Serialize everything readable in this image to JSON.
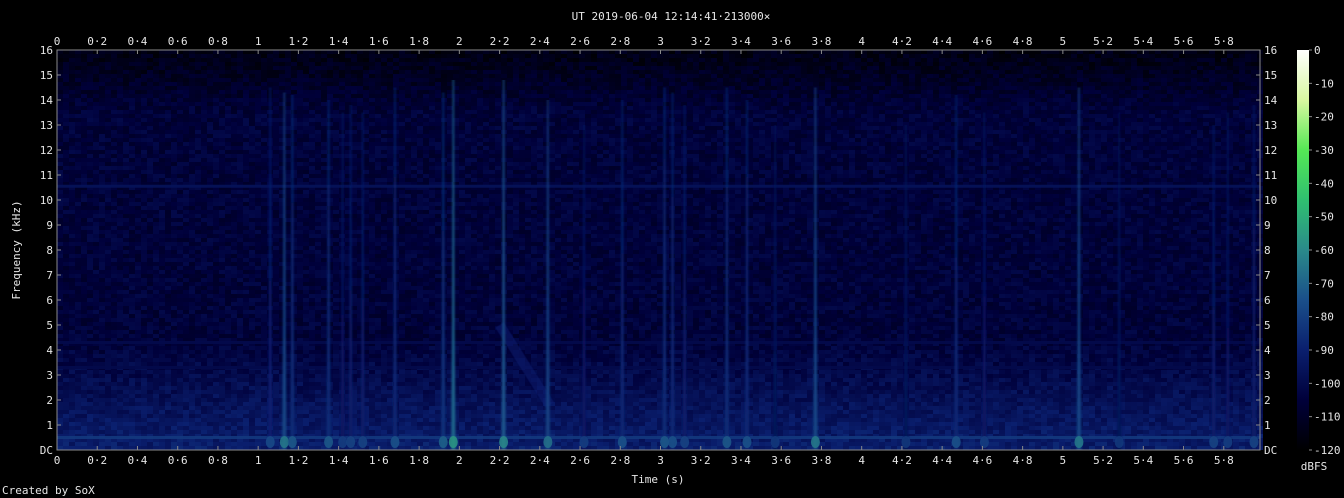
{
  "chart_data": {
    "type": "heatmap",
    "title": "UT 2019-06-04 12:14:41·213000×",
    "xlabel": "Time (s)",
    "ylabel": "Frequency (kHz)",
    "xlim": [
      0,
      5.98
    ],
    "ylim": [
      0,
      16
    ],
    "x_ticks": [
      "0",
      "0·2",
      "0·4",
      "0·6",
      "0·8",
      "1",
      "1·2",
      "1·4",
      "1·6",
      "1·8",
      "2",
      "2·2",
      "2·4",
      "2·6",
      "2·8",
      "3",
      "3·2",
      "3·4",
      "3·6",
      "3·8",
      "4",
      "4·2",
      "4·4",
      "4·6",
      "4·8",
      "5",
      "5·2",
      "5·4",
      "5·6",
      "5·8"
    ],
    "y_ticks": [
      "DC",
      "1",
      "2",
      "3",
      "4",
      "5",
      "6",
      "7",
      "8",
      "9",
      "10",
      "11",
      "12",
      "13",
      "14",
      "15",
      "16"
    ],
    "colorbar": {
      "label": "dBFS",
      "range": [
        -120,
        0
      ],
      "ticks": [
        "0",
        "-10",
        "-20",
        "-30",
        "-40",
        "-50",
        "-60",
        "-70",
        "-80",
        "-90",
        "-100",
        "-110",
        "-120"
      ],
      "colors": [
        "#000000",
        "#00003a",
        "#0a1f6e",
        "#1a4f8a",
        "#2a8a8a",
        "#2fc070",
        "#55e855",
        "#d8f8a0",
        "#ffffff"
      ]
    },
    "background_level_dbfs": -105,
    "horizontal_bands": [
      {
        "freq_khz": 0.5,
        "level_dbfs": -82
      },
      {
        "freq_khz": 3.3,
        "level_dbfs": -100
      },
      {
        "freq_khz": 4.3,
        "level_dbfs": -100
      },
      {
        "freq_khz": 10.55,
        "level_dbfs": -96
      }
    ],
    "clicks": [
      {
        "t": 1.06,
        "fmax": 14.5,
        "db": -90
      },
      {
        "t": 1.13,
        "fmax": 14.3,
        "db": -78
      },
      {
        "t": 1.17,
        "fmax": 14.2,
        "db": -86
      },
      {
        "t": 1.35,
        "fmax": 14.0,
        "db": -86
      },
      {
        "t": 1.42,
        "fmax": 13.5,
        "db": -94
      },
      {
        "t": 1.46,
        "fmax": 13.8,
        "db": -92
      },
      {
        "t": 1.52,
        "fmax": 13.5,
        "db": -92
      },
      {
        "t": 1.68,
        "fmax": 14.5,
        "db": -88
      },
      {
        "t": 1.92,
        "fmax": 14.3,
        "db": -84
      },
      {
        "t": 1.97,
        "fmax": 14.8,
        "db": -70
      },
      {
        "t": 2.22,
        "fmax": 14.8,
        "db": -74
      },
      {
        "t": 2.44,
        "fmax": 14.0,
        "db": -80
      },
      {
        "t": 2.62,
        "fmax": 13.0,
        "db": -94
      },
      {
        "t": 2.81,
        "fmax": 14.0,
        "db": -88
      },
      {
        "t": 3.02,
        "fmax": 14.5,
        "db": -86
      },
      {
        "t": 3.06,
        "fmax": 14.3,
        "db": -88
      },
      {
        "t": 3.12,
        "fmax": 13.8,
        "db": -92
      },
      {
        "t": 3.33,
        "fmax": 14.5,
        "db": -86
      },
      {
        "t": 3.43,
        "fmax": 14.0,
        "db": -88
      },
      {
        "t": 3.57,
        "fmax": 13.0,
        "db": -96
      },
      {
        "t": 3.77,
        "fmax": 14.5,
        "db": -78
      },
      {
        "t": 4.22,
        "fmax": 13.0,
        "db": -96
      },
      {
        "t": 4.47,
        "fmax": 14.2,
        "db": -88
      },
      {
        "t": 4.61,
        "fmax": 13.5,
        "db": -94
      },
      {
        "t": 5.08,
        "fmax": 14.5,
        "db": -78
      },
      {
        "t": 5.28,
        "fmax": 13.5,
        "db": -96
      },
      {
        "t": 5.75,
        "fmax": 13.0,
        "db": -92
      },
      {
        "t": 5.82,
        "fmax": 13.5,
        "db": -94
      },
      {
        "t": 5.95,
        "fmax": 13.8,
        "db": -92
      }
    ],
    "sweeps": [
      {
        "t_start": 2.2,
        "f_start": 5.0,
        "t_end": 2.45,
        "f_end": 1.8,
        "db": -90
      }
    ],
    "grid": false
  },
  "credit": "Created by SoX"
}
